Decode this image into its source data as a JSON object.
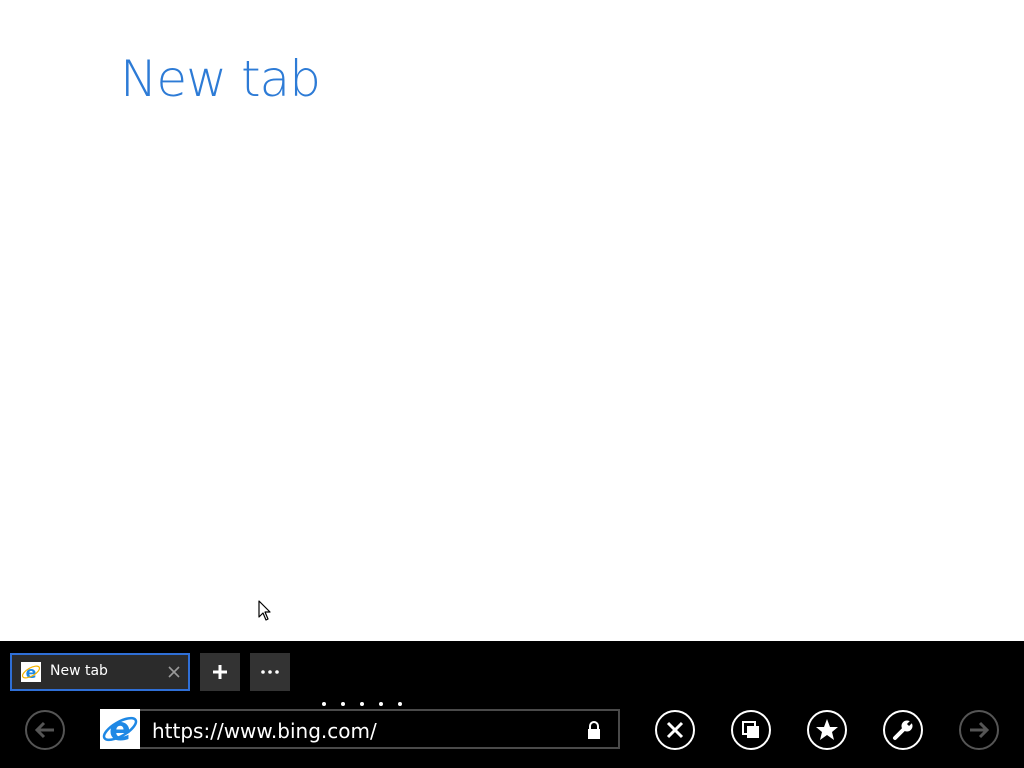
{
  "page": {
    "title": "New tab"
  },
  "tabs": [
    {
      "label": "New tab",
      "active": true
    }
  ],
  "tab_actions": {
    "new_tab_icon": "plus-icon",
    "more_icon": "ellipsis-icon"
  },
  "address_bar": {
    "url": "https://www.bing.com/",
    "secure": true
  },
  "navigation": {
    "back_icon": "arrow-left-icon",
    "forward_icon": "arrow-right-icon",
    "stop_icon": "close-icon",
    "tabs_icon": "tabs-icon",
    "favorites_icon": "star-icon",
    "tools_icon": "wrench-icon"
  },
  "colors": {
    "title": "#2d7bd6",
    "appbar_background": "#000000",
    "tab_border": "#2f6fd6",
    "ie_logo": "#1e88e5"
  }
}
